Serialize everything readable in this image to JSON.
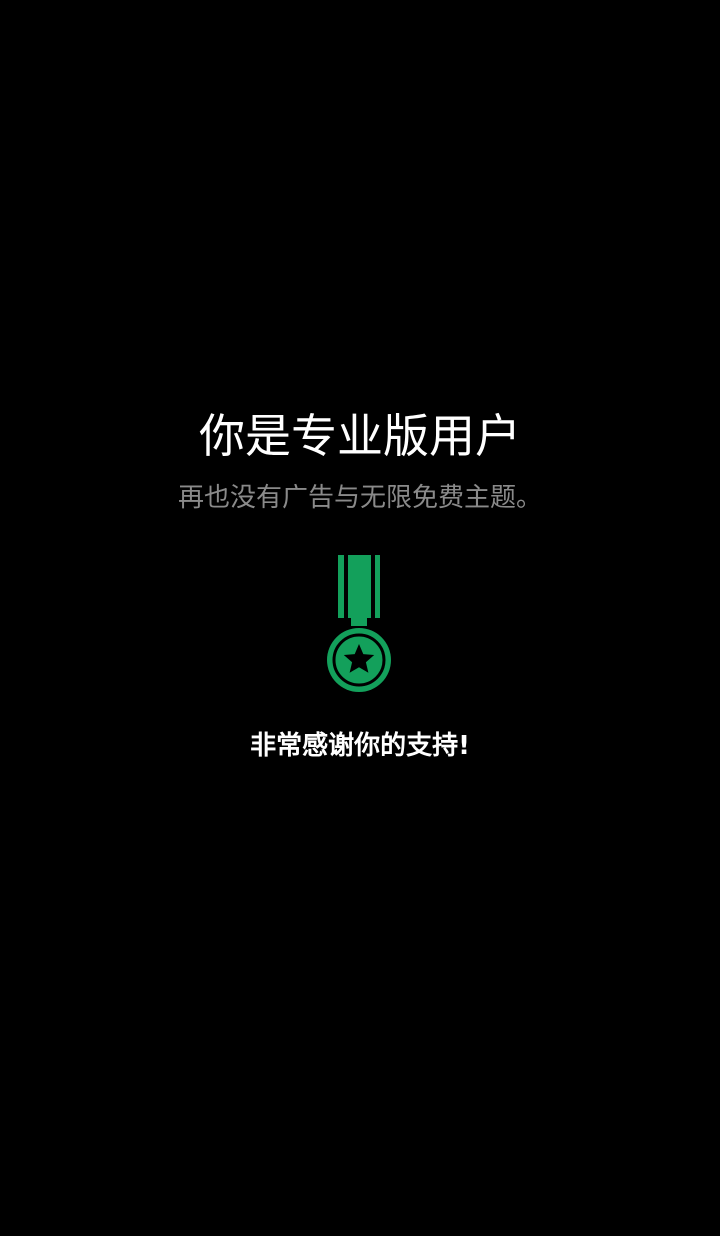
{
  "pro": {
    "title": "你是专业版用户",
    "subtitle": "再也没有广告与无限免费主题。",
    "thanks": "非常感谢你的支持!"
  },
  "medal": {
    "icon": "medal-icon",
    "color": "#13a05b",
    "star_color": "#000000"
  },
  "colors": {
    "background": "#000000",
    "title": "#ffffff",
    "subtitle": "#8a8a8a"
  }
}
